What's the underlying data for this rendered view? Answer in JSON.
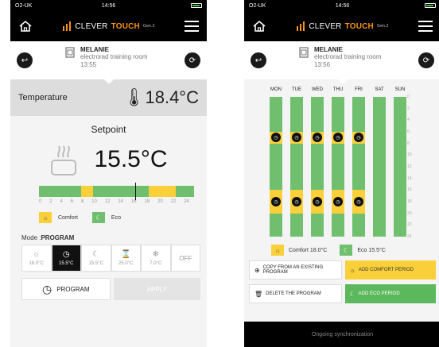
{
  "status": {
    "carrier": "O2-UK",
    "time": "14:56"
  },
  "brand": {
    "name_a": "CLEVER",
    "name_b": "TOUCH",
    "gen": "Gen.2"
  },
  "room": {
    "name": "MELANIE",
    "location": "electrorad training room"
  },
  "left": {
    "room_time": "13:55",
    "temperature_label": "Temperature",
    "temperature_value": "18.4°C",
    "setpoint_label": "Setpoint",
    "setpoint_value": "15.5°C",
    "tick_labels": [
      "0",
      "2",
      "4",
      "6",
      "8",
      "10",
      "12",
      "14",
      "16",
      "18",
      "20",
      "22",
      "24"
    ],
    "legend": {
      "comfort": "Comfort",
      "eco": "Eco"
    },
    "mode_label": "Mode :",
    "mode_value": "PROGRAM",
    "modes": [
      {
        "icon": "sun-icon",
        "value": "18.0°C"
      },
      {
        "icon": "clock-icon",
        "value": "15.5°C"
      },
      {
        "icon": "moon-icon",
        "value": "15.5°C"
      },
      {
        "icon": "hourglass-icon",
        "value": "25.0°C"
      },
      {
        "icon": "snowflake-icon",
        "value": "7.0°C"
      },
      {
        "icon": "off-icon",
        "value": "OFF"
      }
    ],
    "program_button": "PROGRAM",
    "apply_button": "APPLY"
  },
  "right": {
    "room_time": "13:56",
    "days": [
      "MON",
      "TUE",
      "WED",
      "THU",
      "FRI",
      "SAT",
      "SUN"
    ],
    "axis_labels": [
      "0",
      "2",
      "4",
      "6",
      "8",
      "10",
      "12",
      "14",
      "16",
      "18",
      "20",
      "22",
      "24"
    ],
    "comfort_label": "Comfort 18.0°C",
    "eco_label": "Eco 15.5°C",
    "copy_button": "COPY FROM AN EXISTING PROGRAM",
    "add_comfort_button": "ADD COMFORT PERIOD",
    "delete_button": "DELETE THE PROGRAM",
    "add_eco_button": "ADD ECO PERIOD",
    "sync_text": "Ongoing synchronization"
  },
  "colors": {
    "comfort": "#f9d03a",
    "eco": "#6fbf6f",
    "accent": "#f7941d"
  }
}
